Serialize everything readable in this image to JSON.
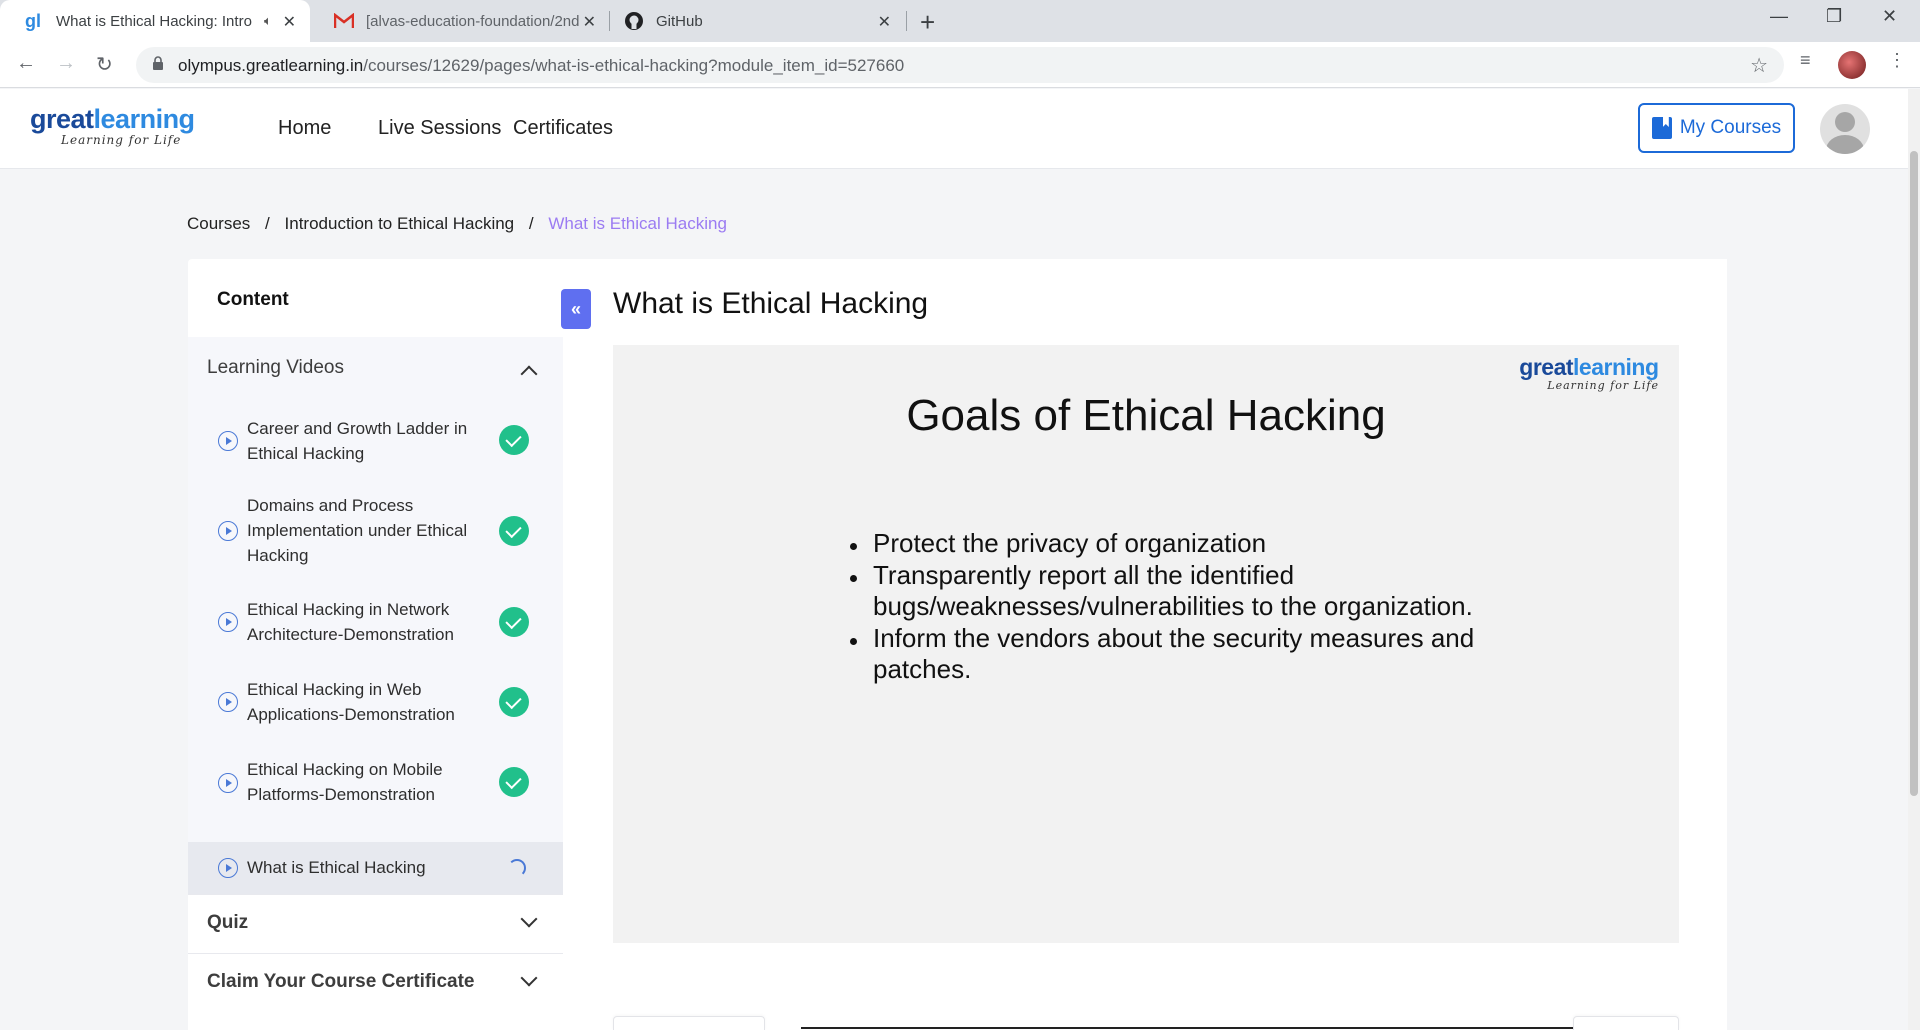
{
  "browser": {
    "tabs": [
      {
        "title": "What is Ethical Hacking: Intro",
        "active": true
      },
      {
        "title": "[alvas-education-foundation/2nd",
        "active": false
      },
      {
        "title": "GitHub",
        "active": false
      }
    ],
    "url_host": "olympus.greatlearning.in",
    "url_path": "/courses/12629/pages/what-is-ethical-hacking?module_item_id=527660"
  },
  "header": {
    "logo_main_1": "great",
    "logo_main_2": "learning",
    "logo_tagline": "Learning for Life",
    "nav": [
      "Home",
      "Live Sessions",
      "Certificates"
    ],
    "my_courses": "My Courses"
  },
  "breadcrumb": {
    "items": [
      "Courses",
      "Introduction to Ethical Hacking"
    ],
    "current": "What is Ethical Hacking",
    "separator": "/"
  },
  "sidebar": {
    "title": "Content",
    "sections": [
      {
        "label": "Learning Videos",
        "expanded": true,
        "lessons": [
          {
            "label": "Career and Growth Ladder in Ethical Hacking",
            "status": "completed"
          },
          {
            "label": "Domains and Process Implementation under Ethical Hacking",
            "status": "completed"
          },
          {
            "label": "Ethical Hacking in Network Architecture-Demonstration",
            "status": "completed"
          },
          {
            "label": "Ethical Hacking in Web Applications-Demonstration",
            "status": "completed"
          },
          {
            "label": "Ethical Hacking on Mobile Platforms-Demonstration",
            "status": "completed"
          },
          {
            "label": "What is Ethical Hacking",
            "status": "in-progress"
          }
        ]
      },
      {
        "label": "Quiz",
        "expanded": false
      },
      {
        "label": "Claim Your Course Certificate",
        "expanded": false
      }
    ]
  },
  "main": {
    "title": "What is Ethical Hacking",
    "slide": {
      "title": "Goals of Ethical Hacking",
      "bullets": [
        "Protect the privacy of organization",
        "Transparently report all the identified bugs/weaknesses/vulnerabilities to the organization.",
        "Inform the vendors about the security measures and patches."
      ]
    }
  },
  "colors": {
    "accent": "#1c6ad8",
    "breadcrumb_current": "#9b7bf2",
    "completed": "#21c08b",
    "collapse_button": "#5f6ff0"
  }
}
